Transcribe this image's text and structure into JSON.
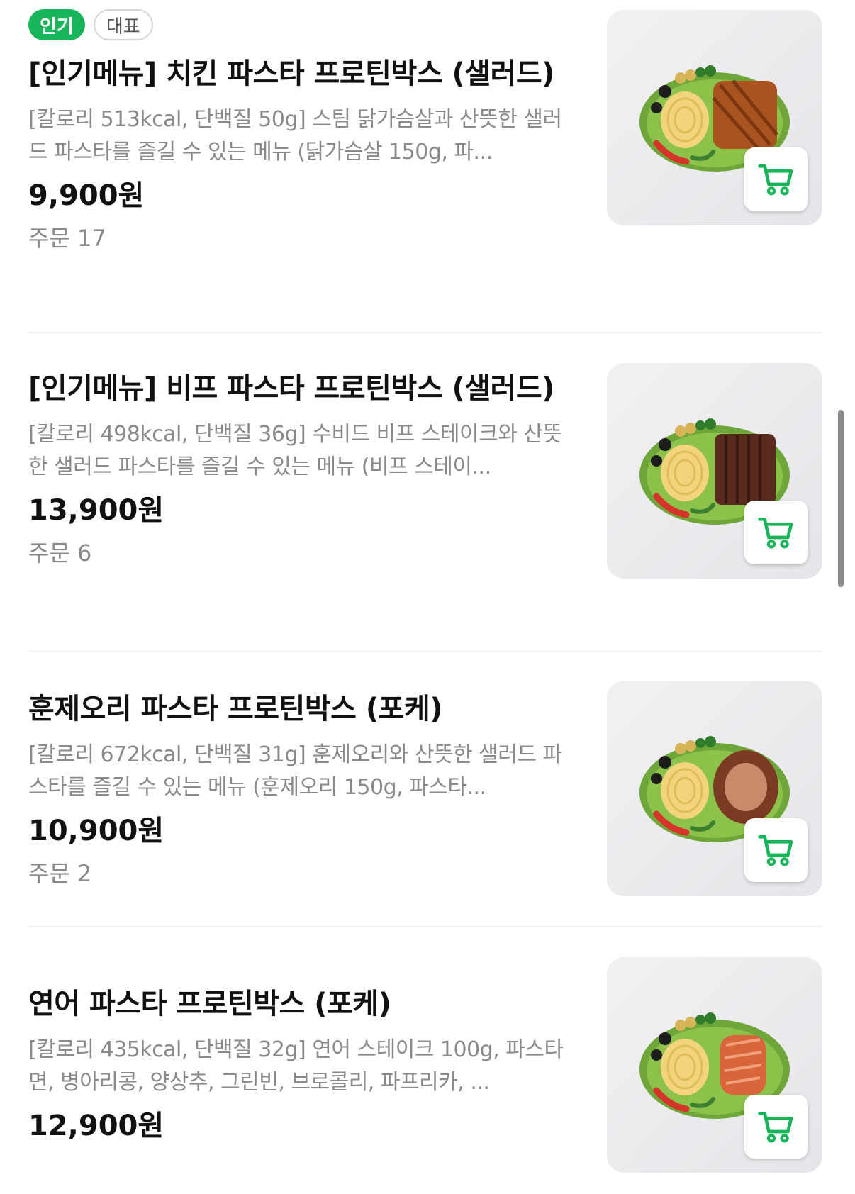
{
  "items": [
    {
      "badges": {
        "popular": "인기",
        "representative": "대표"
      },
      "title": "[인기메뉴] 치킨 파스타 프로틴박스 (샐러드)",
      "description": "[칼로리 513kcal, 단백질 50g] 스팀 닭가슴살과 산뜻한 샐러드 파스타를 즐길 수 있는 메뉴 (닭가슴살 150g, 파...",
      "price": "9,900원",
      "orders": "주문 17",
      "meat": "chicken"
    },
    {
      "title": "[인기메뉴] 비프 파스타 프로틴박스 (샐러드)",
      "description": "[칼로리 498kcal, 단백질 36g] 수비드 비프 스테이크와 산뜻한 샐러드 파스타를 즐길 수 있는 메뉴 (비프 스테이...",
      "price": "13,900원",
      "orders": "주문 6",
      "meat": "beef"
    },
    {
      "title": "훈제오리 파스타 프로틴박스 (포케)",
      "description": "[칼로리 672kcal, 단백질 31g] 훈제오리와 산뜻한 샐러드 파스타를 즐길 수 있는 메뉴 (훈제오리 150g, 파스타...",
      "price": "10,900원",
      "orders": "주문 2",
      "meat": "duck"
    },
    {
      "title": "연어 파스타 프로틴박스 (포케)",
      "description": "[칼로리 435kcal, 단백질 32g] 연어 스테이크 100g, 파스타면, 병아리콩, 양상추, 그린빈, 브로콜리, 파프리카, ...",
      "price": "12,900원",
      "meat": "salmon"
    }
  ],
  "colors": {
    "accent": "#18b45a",
    "chicken": "#a9541f",
    "beef": "#5a2a1e",
    "duck": "#7b3a22",
    "salmon": "#d9653a"
  },
  "icons": {
    "cart": "cart-icon"
  }
}
